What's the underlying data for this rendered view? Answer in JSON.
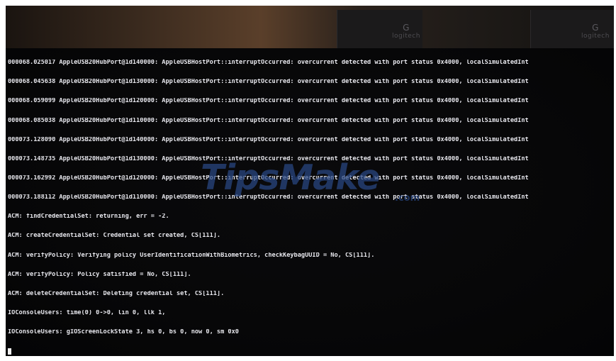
{
  "console_lines": [
    "000068.025017 AppleUSB20HubPort@1d140000: AppleUSBHostPort::interruptOccurred: overcurrent detected with port status 0x4000, localSimulatedInt",
    "000068.045638 AppleUSB20HubPort@1d130000: AppleUSBHostPort::interruptOccurred: overcurrent detected with port status 0x4000, localSimulatedInt",
    "000068.059099 AppleUSB20HubPort@1d120000: AppleUSBHostPort::interruptOccurred: overcurrent detected with port status 0x4000, localSimulatedInt",
    "000068.085038 AppleUSB20HubPort@1d110000: AppleUSBHostPort::interruptOccurred: overcurrent detected with port status 0x4000, localSimulatedInt",
    "000073.128090 AppleUSB20HubPort@1d140000: AppleUSBHostPort::interruptOccurred: overcurrent detected with port status 0x4000, localSimulatedInt",
    "000073.148735 AppleUSB20HubPort@1d130000: AppleUSBHostPort::interruptOccurred: overcurrent detected with port status 0x4000, localSimulatedInt",
    "000073.162992 AppleUSB20HubPort@1d120000: AppleUSBHostPort::interruptOccurred: overcurrent detected with port status 0x4000, localSimulatedInt",
    "000073.188112 AppleUSB20HubPort@1d110000: AppleUSBHostPort::interruptOccurred: overcurrent detected with port status 0x4000, localSimulatedInt",
    "ACM: findCredentialSet: returning, err = -2.",
    "ACM: createCredentialSet: Credential set created, CS[111].",
    "ACM: verifyPolicy: Verifying policy UserIdentificationWithBiometrics, checkKeybagUUID = No, CS[111].",
    "ACM: verifyPolicy: Policy satisfied = No, CS[111].",
    "ACM: deleteCredentialSet: Deleting credential set, CS[111].",
    "IOConsoleUsers: time(0) 0->0, lin 0, llk 1,",
    "IOConsoleUsers: gIOScreenLockState 3, hs 0, bs 0, now 0, sm 0x0"
  ],
  "watermark": {
    "text": "TipsMake",
    "suffix": ".com",
    "color": "#2a4884"
  },
  "speaker_brand": "logitech",
  "colors": {
    "console_text": "#e6e6ec",
    "screen_background": "#070708",
    "bezel": "#3a2a1e"
  }
}
